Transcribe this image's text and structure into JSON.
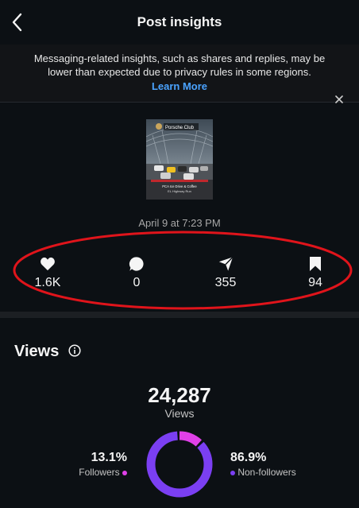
{
  "header": {
    "title": "Post insights",
    "back_icon": "chevron-left-icon"
  },
  "banner": {
    "text": "Messaging-related insights, such as shares and replies, may be lower than expected due to privacy rules in some regions.",
    "link": "Learn More",
    "close_icon": "close-icon",
    "link_color": "#4aa3ff"
  },
  "post": {
    "date": "April 9 at 7:23 PM",
    "thumbnail": {
      "brand": "Porsche Club",
      "caption_line1": "PCA Ice Drive & Coffee",
      "caption_line2": "EL Highway Run"
    }
  },
  "metrics": [
    {
      "icon": "heart-icon",
      "value": "1.6K"
    },
    {
      "icon": "comment-icon",
      "value": "0"
    },
    {
      "icon": "share-icon",
      "value": "355"
    },
    {
      "icon": "bookmark-icon",
      "value": "94"
    }
  ],
  "annotation": {
    "color": "#e0141b"
  },
  "views": {
    "title": "Views",
    "info_icon": "info-icon",
    "total": "24,287",
    "total_label": "Views",
    "followers": {
      "pct": "13.1%",
      "label": "Followers",
      "value": 0.131,
      "color": "#e040e8"
    },
    "non_followers": {
      "pct": "86.9%",
      "label": "Non-followers",
      "value": 0.869,
      "color": "#7b3ff2"
    }
  }
}
